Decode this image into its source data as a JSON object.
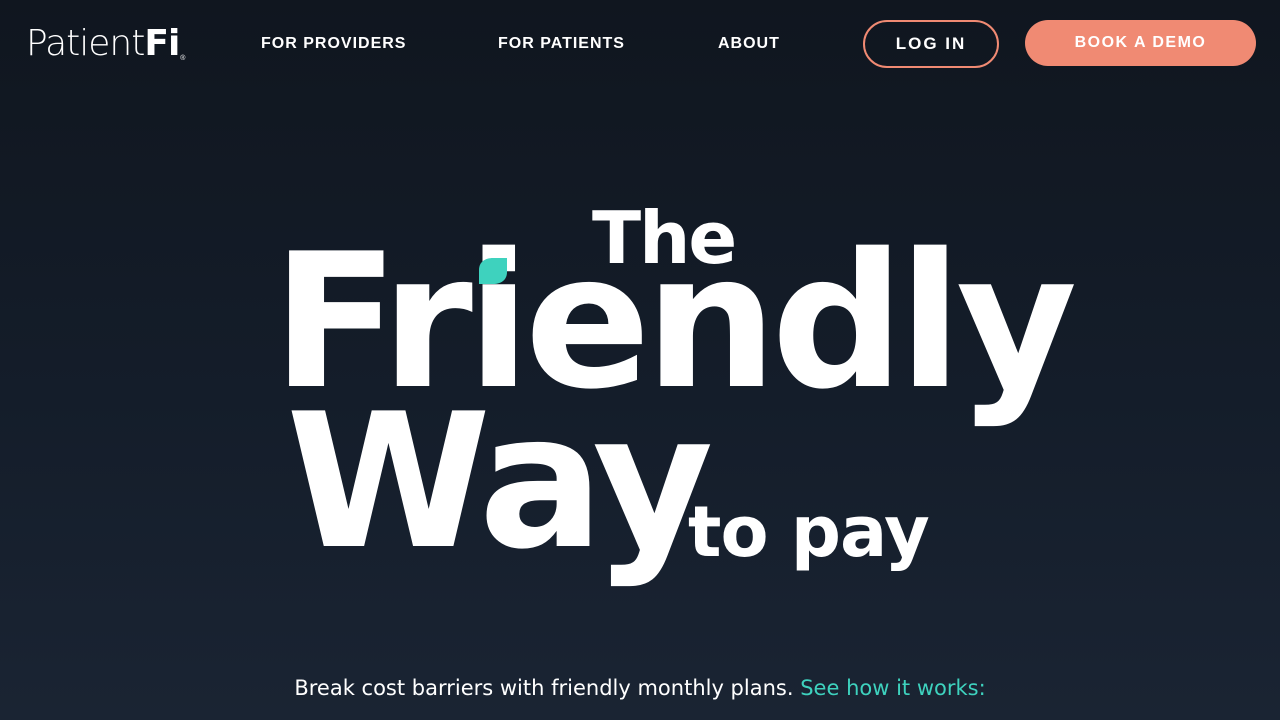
{
  "header": {
    "logo": {
      "patient": "Patient",
      "fi": "Fi",
      "registered": "®"
    },
    "nav": [
      {
        "label": "FOR PROVIDERS"
      },
      {
        "label": "FOR PATIENTS"
      },
      {
        "label": "ABOUT"
      }
    ],
    "login_label": "LOG IN",
    "demo_label": "BOOK A DEMO"
  },
  "hero": {
    "the": "The",
    "friendly": "Friendly",
    "way": "Way",
    "to_pay": "to pay",
    "tagline": "Break cost barriers with friendly monthly plans.",
    "tagline_link": "See how it works:"
  },
  "colors": {
    "background": "#10161f",
    "accent_coral": "#f08a73",
    "accent_teal": "#3ed2be",
    "text": "#ffffff"
  },
  "icons": {
    "leaf": "leaf-icon"
  }
}
